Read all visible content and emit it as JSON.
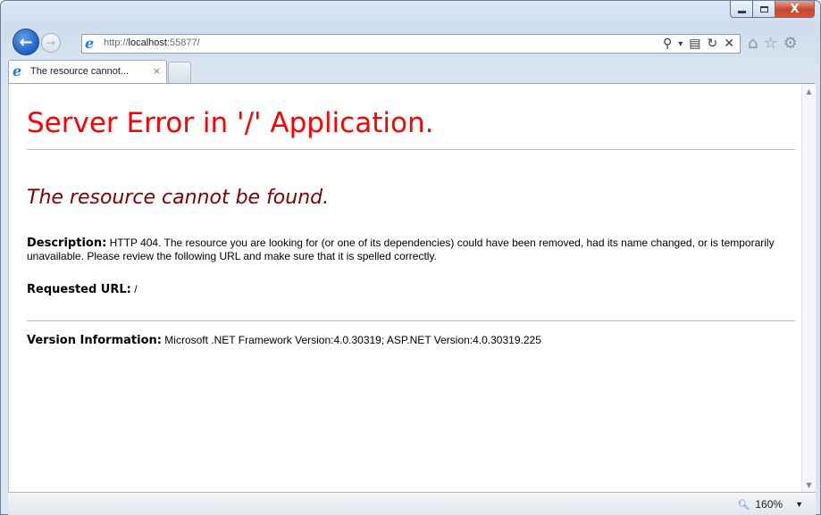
{
  "window": {
    "caption_buttons": {
      "close": "X"
    }
  },
  "nav": {
    "back_glyph": "←",
    "forward_glyph": "→",
    "url_prefix": "http://",
    "url_host": "localhost",
    "url_suffix": ":55877/",
    "address_tools": {
      "search": "⚲",
      "dropdown": "▾",
      "compat": "▤",
      "refresh": "↻",
      "stop": "✕"
    },
    "right_icons": {
      "home": "⌂",
      "favorites": "☆",
      "tools": "⚙"
    }
  },
  "tab": {
    "title": "The resource cannot...",
    "close": "×"
  },
  "content": {
    "heading": "Server Error in '/' Application.",
    "subheading": "The resource cannot be found.",
    "description_label": "Description:",
    "description_text": "HTTP 404. The resource you are looking for (or one of its dependencies) could have been removed, had its name changed, or is temporarily unavailable.  Please review the following URL and make sure that it is spelled correctly.",
    "requested_url_label": "Requested URL:",
    "requested_url_value": "/",
    "version_label": "Version Information:",
    "version_value": "Microsoft .NET Framework Version:4.0.30319; ASP.NET Version:4.0.30319.225"
  },
  "statusbar": {
    "zoom_level": "160%",
    "zoom_dropdown": "▼"
  },
  "colors": {
    "heading": "#ff0000",
    "subheading": "#800000"
  }
}
